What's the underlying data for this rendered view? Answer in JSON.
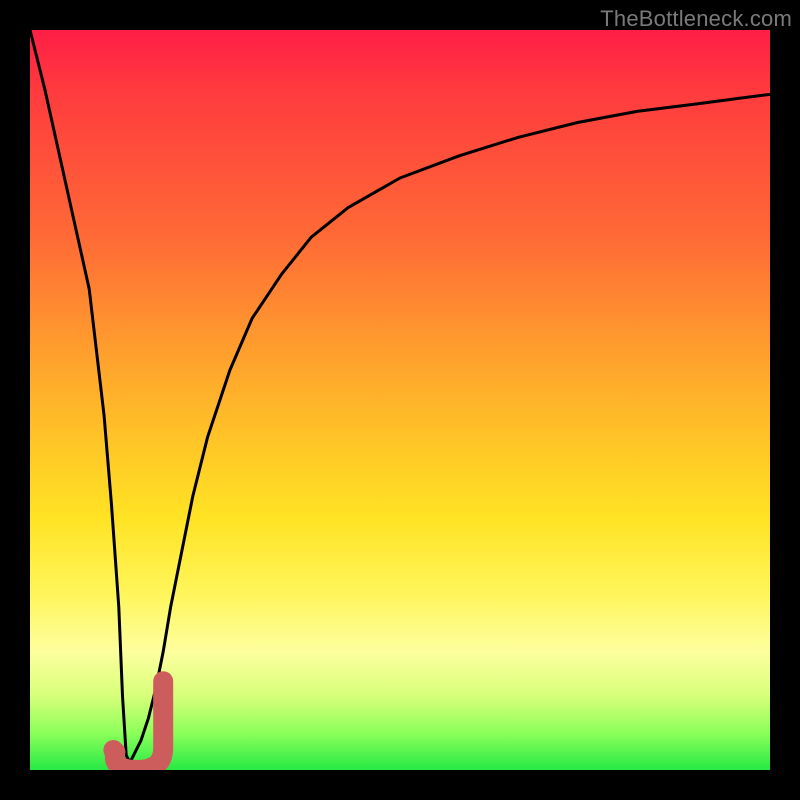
{
  "watermark": "TheBottleneck.com",
  "chart_data": {
    "type": "line",
    "title": "",
    "xlabel": "",
    "ylabel": "",
    "xlim": [
      0,
      100
    ],
    "ylim": [
      0,
      100
    ],
    "series": [
      {
        "name": "bottleneck-curve",
        "x": [
          0,
          2,
          4,
          6,
          8,
          10,
          11,
          12,
          12.5,
          13,
          13.5,
          14,
          15,
          16,
          17,
          18,
          19,
          20,
          22,
          24,
          27,
          30,
          34,
          38,
          43,
          50,
          58,
          66,
          74,
          82,
          90,
          96,
          100
        ],
        "y": [
          100,
          92,
          83,
          74,
          65,
          48,
          36,
          22,
          10,
          2,
          1,
          2,
          4,
          7,
          11,
          16,
          22,
          27,
          37,
          45,
          54,
          61,
          67,
          72,
          76,
          80,
          83,
          85.5,
          87.5,
          89,
          90,
          90.8,
          91.3
        ]
      },
      {
        "name": "optimal-marker",
        "shape": "j-hook",
        "color": "#cd5c5c",
        "center": [
          13.5,
          3
        ],
        "extent": [
          11,
          18,
          0,
          12
        ]
      }
    ],
    "gradient_colors": {
      "top": "#ff1e46",
      "mid_high": "#ff9a2e",
      "mid": "#ffe324",
      "mid_low": "#fdff9e",
      "bottom": "#26e944"
    }
  }
}
